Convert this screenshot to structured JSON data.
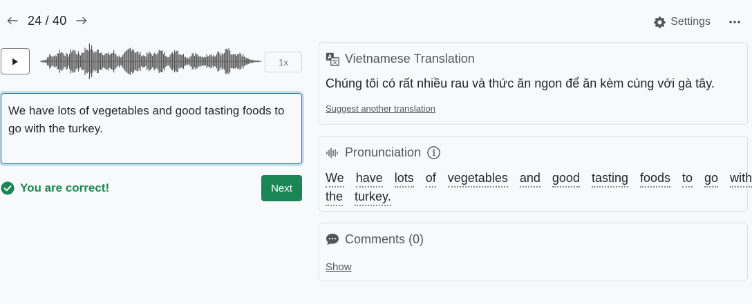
{
  "nav": {
    "counter": "24 / 40",
    "settings_label": "Settings"
  },
  "audio": {
    "speed_label": "1x"
  },
  "answer": {
    "value": "We have lots of vegetables and good tasting foods to go with the turkey."
  },
  "feedback": {
    "message": "You are correct!",
    "next_label": "Next"
  },
  "translation": {
    "title": "Vietnamese Translation",
    "text": "Chúng tôi có rất nhiều rau và thức ăn ngon để ăn kèm cùng với gà tây.",
    "suggest_label": "Suggest another translation"
  },
  "pronunciation": {
    "title": "Pronunciation",
    "words_line1": [
      "We",
      "have",
      "lots",
      "of",
      "vegetables",
      "and",
      "good",
      "tasting",
      "foods",
      "to",
      "go",
      "with"
    ],
    "words_line2": [
      "the",
      "turkey."
    ]
  },
  "comments": {
    "title": "Comments (0)",
    "show_label": "Show"
  },
  "colors": {
    "accent_green": "#198754",
    "text_muted": "#555555",
    "border": "#dee2e6"
  },
  "icons": {
    "prev": "arrow-left-icon",
    "next": "arrow-right-icon",
    "settings": "gear-icon",
    "more": "ellipsis-icon",
    "play": "play-icon",
    "translate": "translate-icon",
    "pronunciation": "soundwave-icon",
    "info": "info-icon",
    "comments": "chat-bubble-icon",
    "correct": "check-circle-icon"
  }
}
